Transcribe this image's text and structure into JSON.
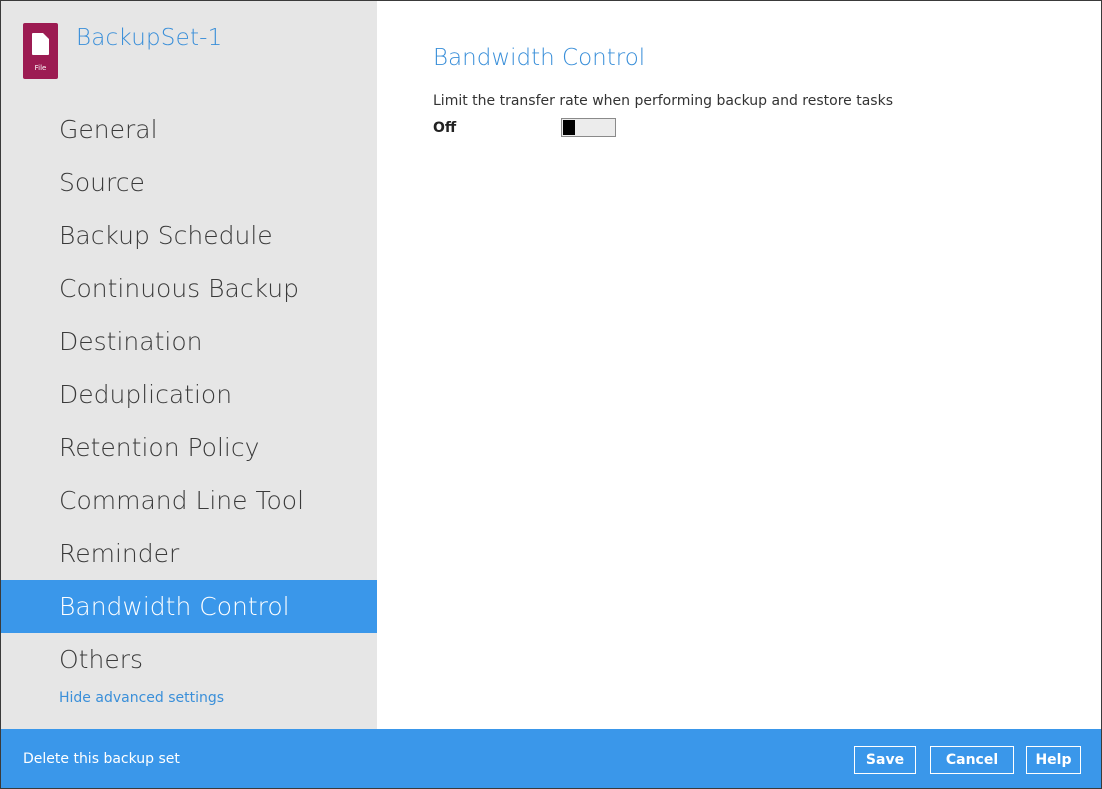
{
  "app": {
    "backup_set_name": "BackupSet-1",
    "file_icon_tag": "File"
  },
  "sidebar": {
    "items": [
      {
        "label": "General"
      },
      {
        "label": "Source"
      },
      {
        "label": "Backup Schedule"
      },
      {
        "label": "Continuous Backup"
      },
      {
        "label": "Destination"
      },
      {
        "label": "Deduplication"
      },
      {
        "label": "Retention Policy"
      },
      {
        "label": "Command Line Tool"
      },
      {
        "label": "Reminder"
      },
      {
        "label": "Bandwidth Control",
        "active": true
      },
      {
        "label": "Others"
      }
    ],
    "advanced_link": "Hide advanced settings"
  },
  "main": {
    "title": "Bandwidth Control",
    "description": "Limit the transfer rate when performing backup and restore tasks",
    "toggle": {
      "state_label": "Off",
      "on": false
    }
  },
  "footer": {
    "delete_label": "Delete this backup set",
    "save_label": "Save",
    "cancel_label": "Cancel",
    "help_label": "Help"
  },
  "colors": {
    "accent": "#3a97ea",
    "brand_text": "#3a8fd9",
    "file_icon": "#9c1b52",
    "sidebar_bg": "#e6e6e6"
  }
}
